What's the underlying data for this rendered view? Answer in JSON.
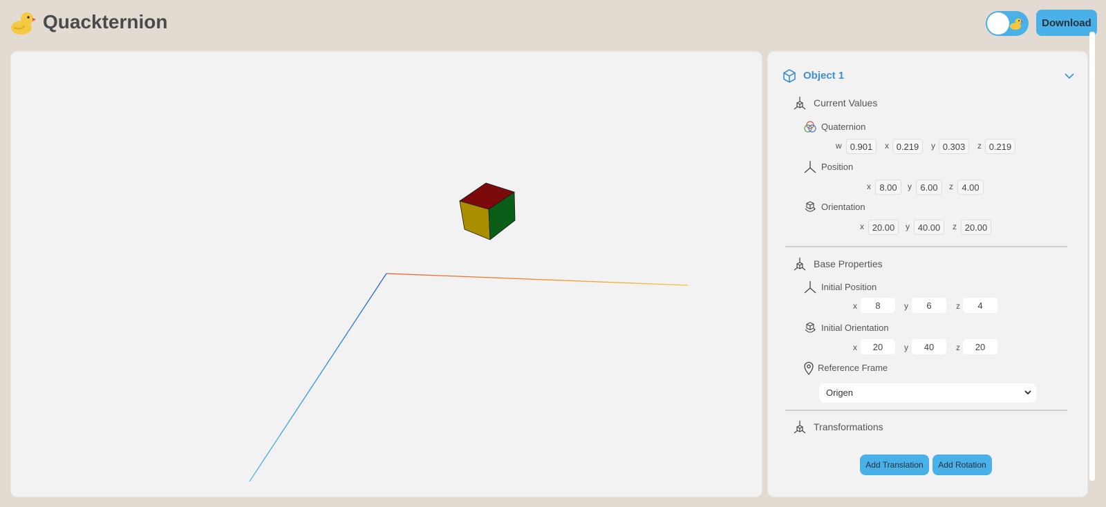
{
  "header": {
    "app_title": "Quackternion",
    "download_label": "Download"
  },
  "icons": {
    "logo": "duck-icon",
    "theme_toggle": "theme-toggle-duck-icon",
    "object": "cube-icon",
    "collapse": "chevron-down-icon",
    "current_values": "axes-cube-icon",
    "quaternion": "quaternion-circles-icon",
    "position": "axes-icon",
    "orientation": "rotate-cube-icon",
    "base_properties": "axes-cube-icon",
    "reference_frame": "location-pin-icon",
    "transformations": "axes-cube-icon"
  },
  "colors": {
    "background": "#e3dbd1",
    "accent": "#4ab0e8",
    "object_title": "#3d8fd0",
    "cube_top": "#7d0a0a",
    "cube_left": "#a98e00",
    "cube_right": "#0b5e18",
    "axis_x": "#f0b030",
    "axis_y": "#9de060",
    "axis_z": "#3aaee8"
  },
  "panel": {
    "object_title": "Object 1",
    "current_values": {
      "title": "Current Values",
      "quaternion": {
        "title": "Quaternion",
        "w_label": "w",
        "w": "0.901",
        "x_label": "x",
        "x": "0.219",
        "y_label": "y",
        "y": "0.303",
        "z_label": "z",
        "z": "0.219"
      },
      "position": {
        "title": "Position",
        "x_label": "x",
        "x": "8.00",
        "y_label": "y",
        "y": "6.00",
        "z_label": "z",
        "z": "4.00"
      },
      "orientation": {
        "title": "Orientation",
        "x_label": "x",
        "x": "20.00",
        "y_label": "y",
        "y": "40.00",
        "z_label": "z",
        "z": "20.00"
      }
    },
    "base_properties": {
      "title": "Base Properties",
      "initial_position": {
        "title": "Initial Position",
        "x_label": "x",
        "x": "8",
        "y_label": "y",
        "y": "6",
        "z_label": "z",
        "z": "4"
      },
      "initial_orientation": {
        "title": "Initial Orientation",
        "x_label": "x",
        "x": "20",
        "y_label": "y",
        "y": "40",
        "z_label": "z",
        "z": "20"
      },
      "reference_frame": {
        "title": "Reference Frame",
        "selected": "Origen"
      }
    },
    "transformations": {
      "title": "Transformations",
      "add_translation_label": "Add Translation",
      "add_rotation_label": "Add Rotation"
    }
  }
}
